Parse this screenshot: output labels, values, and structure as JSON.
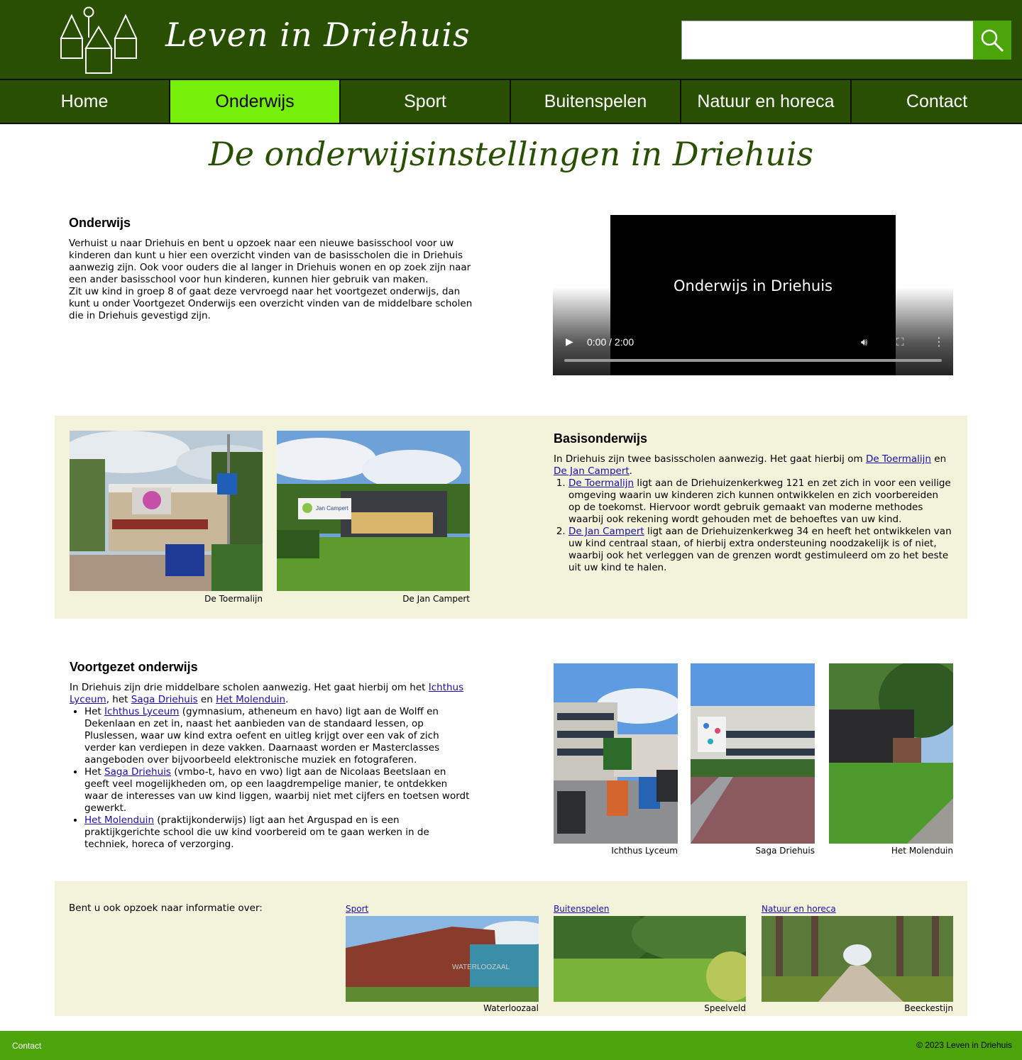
{
  "header": {
    "site_title": "Leven in Driehuis",
    "search_value": "",
    "search_icon": "search-icon"
  },
  "nav": {
    "items": [
      {
        "label": "Home",
        "active": false
      },
      {
        "label": "Onderwijs",
        "active": true
      },
      {
        "label": "Sport",
        "active": false
      },
      {
        "label": "Buitenspelen",
        "active": false
      },
      {
        "label": "Natuur en horeca",
        "active": false
      },
      {
        "label": "Contact",
        "active": false
      }
    ]
  },
  "page_title": "De onderwijsinstellingen in Driehuis",
  "intro": {
    "heading": "Onderwijs",
    "p1": "Verhuist u naar Driehuis en bent u opzoek naar een nieuwe basisschool voor uw kinderen dan kunt u hier een overzicht vinden van de basisscholen die in Driehuis aanwezig zijn. Ook voor ouders die al langer in Driehuis wonen en op zoek zijn naar een ander basisschool voor hun kinderen, kunnen hier gebruik van maken.",
    "p2": "Zit uw kind in groep 8 of gaat deze vervroegd naar het voortgezet onderwijs, dan kunt u onder Voortgezet Onderwijs een overzicht vinden van de middelbare scholen die in Driehuis gevestigd zijn."
  },
  "video": {
    "title": "Onderwijs in Driehuis",
    "time": "0:00 / 2:00",
    "progress": 0
  },
  "basis": {
    "heading": "Basisonderwijs",
    "intro_a": "In Driehuis zijn twee basisscholen aanwezig. Het gaat hierbij om ",
    "link1": "De Toermalijn",
    "intro_b": " en ",
    "link2": "De Jan Campert",
    "intro_c": ".",
    "item1_link": "De Toermalijn",
    "item1_text": " ligt aan de Driehuizenkerkweg 121 en zet zich in voor een veilige omgeving waarin uw kinderen zich kunnen ontwikkelen en zich voorbereiden op de toekomst. Hiervoor wordt gebruik gemaakt van moderne methodes waarbij ook rekening wordt gehouden met de behoeftes van uw kind.",
    "item2_link": "De Jan Campert",
    "item2_text": " ligt aan de Driehuizenkerkweg 34 en heeft het ontwikkelen van uw kind centraal staan, of hierbij extra ondersteuning noodzakelijk is of niet, waarbij ook het verleggen van de grenzen wordt gestimuleerd om zo het beste uit uw kind te halen.",
    "photos": [
      {
        "caption": "De Toermalijn"
      },
      {
        "caption": "De Jan Campert",
        "sign": "Jan Campert"
      }
    ]
  },
  "voortgezet": {
    "heading": "Voortgezet onderwijs",
    "intro_a": "In Driehuis zijn drie middelbare scholen aanwezig. Het gaat hierbij om het ",
    "link1": "Ichthus Lyceum",
    "intro_b": ", het ",
    "link2": "Saga Driehuis",
    "intro_c": " en ",
    "link3": "Het Molenduin",
    "intro_d": ".",
    "item1_pre": "Het ",
    "item1_link": "Ichthus Lyceum",
    "item1_text": " (gymnasium, atheneum en havo) ligt aan de Wolff en Dekenlaan en zet in, naast het aanbieden van de standaard lessen, op Pluslessen, waar uw kind extra oefent en uitleg krijgt over een vak of zich verder kan verdiepen in deze vakken. Daarnaast worden er Masterclasses aangeboden over bijvoorbeeld elektronische muziek en fotograferen.",
    "item2_pre": "Het ",
    "item2_link": "Saga Driehuis",
    "item2_text": " (vmbo-t, havo en vwo) ligt aan de Nicolaas Beetslaan en geeft veel mogelijkheden om, op een laagdrempelige manier, te ontdekken waar de interesses van uw kind liggen, waarbij niet met cijfers en toetsen wordt gewerkt.",
    "item3_link": "Het Molenduin",
    "item3_text": " (praktijkonderwijs) ligt aan het Arguspad en is een praktijkgerichte school die uw kind voorbereid om te gaan werken in de techniek, horeca of verzorging.",
    "photos": [
      {
        "caption": "Ichthus Lyceum"
      },
      {
        "caption": "Saga Driehuis"
      },
      {
        "caption": "Het Molenduin"
      }
    ]
  },
  "more": {
    "lead": "Bent u ook opzoek naar informatie over:",
    "cards": [
      {
        "link": "Sport",
        "caption": "Waterloozaal",
        "sign": "WATERLOOZAAL"
      },
      {
        "link": "Buitenspelen",
        "caption": "Speelveld"
      },
      {
        "link": "Natuur en horeca",
        "caption": "Beeckestijn"
      }
    ]
  },
  "footer": {
    "contact": "Contact",
    "copyright": "© 2023 Leven in Driehuis"
  },
  "colors": {
    "header_green": "#284f02",
    "active_nav": "#76ef0a",
    "footer_green": "#4ba40a",
    "section_bg": "#f3f3dc"
  }
}
